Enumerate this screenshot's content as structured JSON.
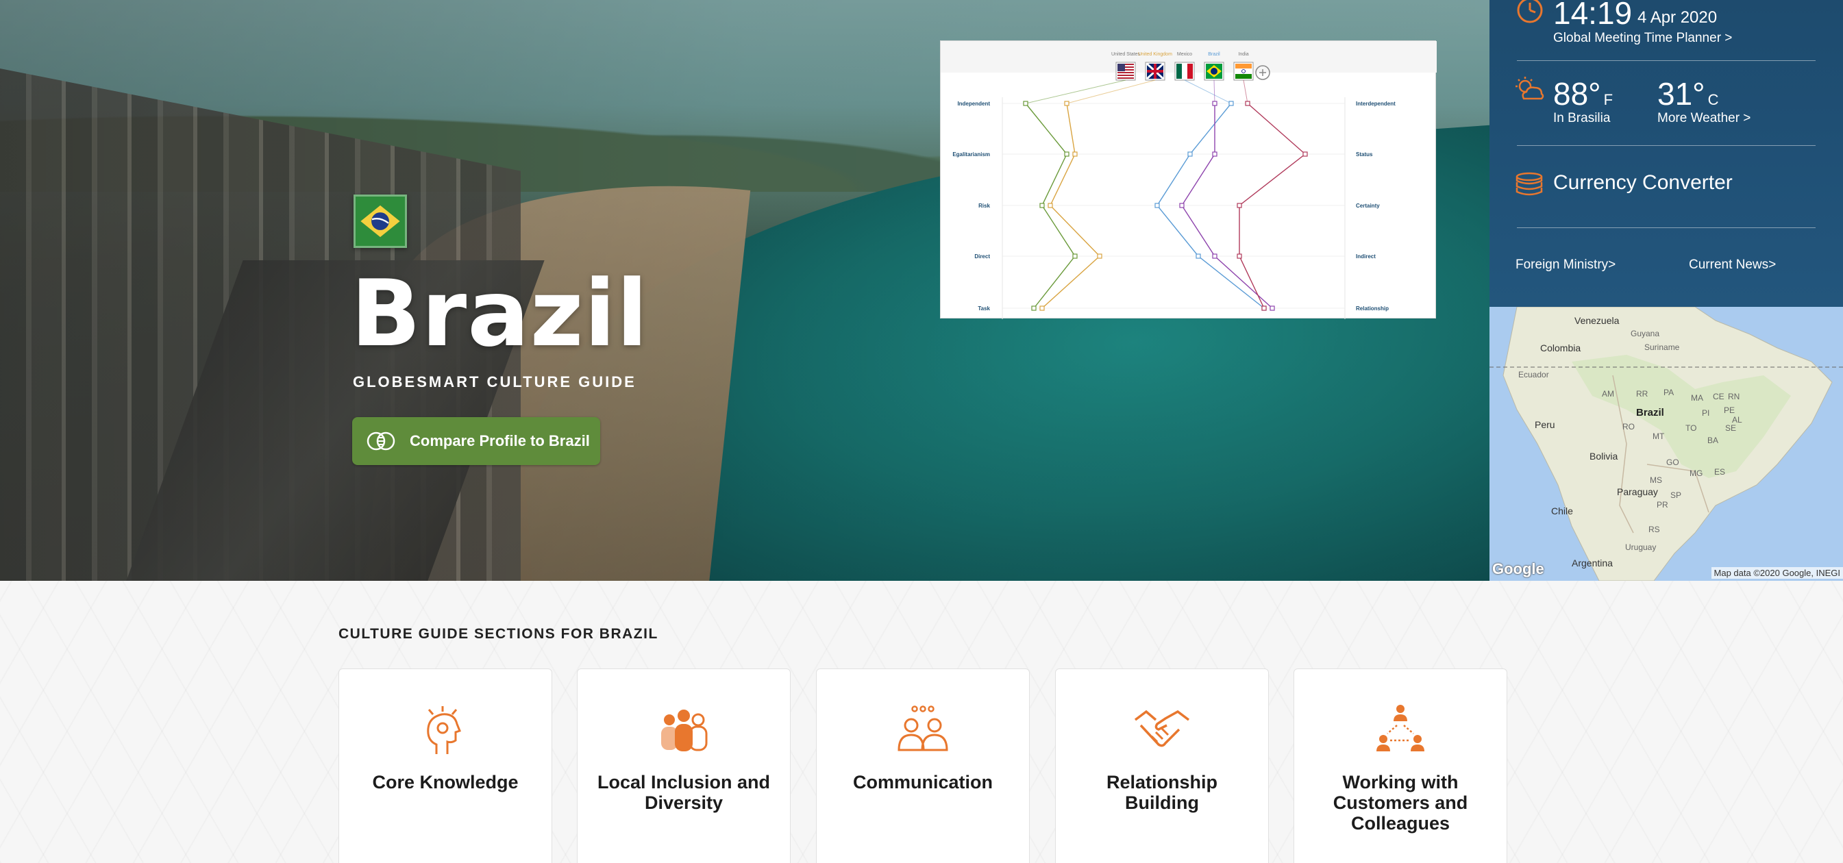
{
  "hero": {
    "country": "Brazil",
    "subtitle": "GLOBESMART CULTURE GUIDE",
    "compare_button": "Compare Profile to Brazil"
  },
  "chart": {
    "flags": [
      {
        "name": "United States",
        "label": "United States"
      },
      {
        "name": "United Kingdom",
        "label": "United Kingdom"
      },
      {
        "name": "Mexico",
        "label": "Mexico"
      },
      {
        "name": "Brazil",
        "label": "Brazil"
      },
      {
        "name": "India",
        "label": "India"
      }
    ],
    "left_labels": [
      "Independent",
      "Egalitarianism",
      "Risk",
      "Direct",
      "Task"
    ],
    "right_labels": [
      "Interdependent",
      "Status",
      "Certainty",
      "Indirect",
      "Relationship"
    ],
    "series_colors": [
      "#6a9a3a",
      "#d9a441",
      "#5a9bd5",
      "#8e44ad",
      "#b03a5b"
    ]
  },
  "chart_data": {
    "type": "line",
    "categories": [
      "Independent",
      "Egalitarianism",
      "Risk",
      "Direct",
      "Task"
    ],
    "series": [
      {
        "name": "United States",
        "values": [
          2,
          7,
          4,
          8,
          3
        ]
      },
      {
        "name": "United Kingdom",
        "values": [
          7,
          8,
          5,
          11,
          4
        ]
      },
      {
        "name": "Mexico",
        "values": [
          27,
          22,
          18,
          23,
          31
        ]
      },
      {
        "name": "Brazil",
        "values": [
          25,
          25,
          21,
          25,
          32
        ]
      },
      {
        "name": "India",
        "values": [
          29,
          36,
          28,
          28,
          31
        ]
      }
    ]
  },
  "side": {
    "time": "14:19",
    "date": "4 Apr 2020",
    "planner": "Global Meeting Time Planner >",
    "temp_f": "88°",
    "unit_f": "F",
    "temp_c": "31°",
    "unit_c": "C",
    "city": "In Brasilia",
    "more_weather": "More Weather >",
    "currency": "Currency Converter",
    "foreign_ministry": "Foreign Ministry>",
    "current_news": "Current News>"
  },
  "map": {
    "labels": {
      "venezuela": "Venezuela",
      "guyana": "Guyana",
      "suriname": "Suriname",
      "colombia": "Colombia",
      "ecuador": "Ecuador",
      "peru": "Peru",
      "brazil": "Brazil",
      "bolivia": "Bolivia",
      "paraguay": "Paraguay",
      "chile": "Chile",
      "uruguay": "Uruguay",
      "argentina": "Argentina",
      "am": "AM",
      "pa": "PA",
      "ma": "MA",
      "ce": "CE",
      "rn": "RN",
      "pe": "PE",
      "to": "TO",
      "ba": "BA",
      "ro": "RO",
      "mt": "MT",
      "go": "GO",
      "mg": "MG",
      "ms": "MS",
      "sp": "SP",
      "pr": "PR",
      "rs": "RS",
      "rr": "RR",
      "pi": "PI",
      "se": "SE",
      "es": "ES",
      "al": "AL"
    },
    "google": "Google",
    "attribution": "Map data ©2020 Google, INEGI"
  },
  "sections": {
    "title": "CULTURE GUIDE SECTIONS FOR BRAZIL",
    "cards": [
      {
        "label": "Core Knowledge"
      },
      {
        "label": "Local Inclusion and Diversity"
      },
      {
        "label": "Communication"
      },
      {
        "label": "Relationship Building"
      },
      {
        "label": "Working with Customers and Colleagues"
      }
    ]
  },
  "colors": {
    "accent_orange": "#e8772e",
    "button_green": "#5f8c3b",
    "panel_blue": "#1f4f74"
  }
}
